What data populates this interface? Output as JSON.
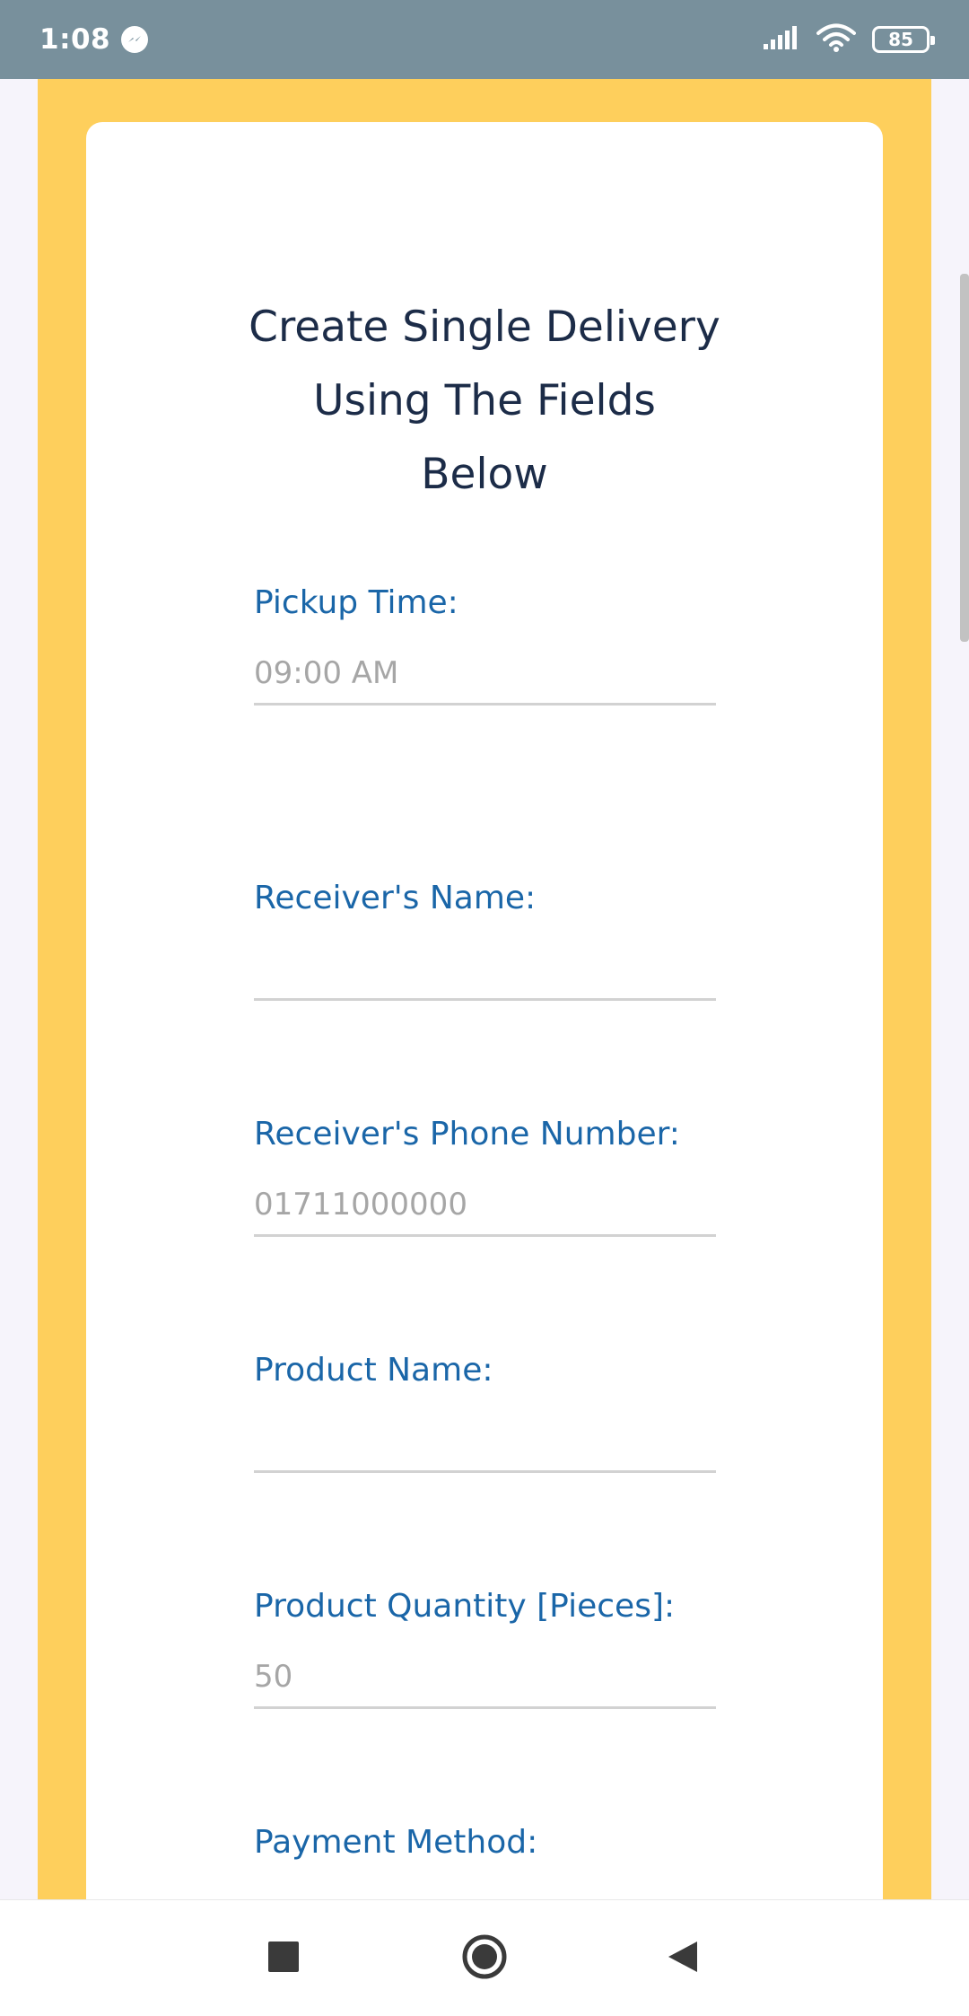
{
  "status_bar": {
    "time": "1:08",
    "battery": "85"
  },
  "form": {
    "title_lines": [
      "Create Single Delivery",
      "Using The Fields",
      "Below"
    ],
    "fields": [
      {
        "label": "Pickup Time:",
        "placeholder": "09:00 AM",
        "value": ""
      },
      {
        "label": "Receiver's Name:",
        "placeholder": "",
        "value": ""
      },
      {
        "label": "Receiver's Phone Number:",
        "placeholder": "01711000000",
        "value": ""
      },
      {
        "label": "Product Name:",
        "placeholder": "",
        "value": ""
      },
      {
        "label": "Product Quantity [Pieces]:",
        "placeholder": "50",
        "value": ""
      },
      {
        "label": "Payment Method:"
      }
    ]
  },
  "colors": {
    "status_bar": "#78909c",
    "frame": "#fecf5c",
    "label": "#1a66a8",
    "title": "#1c2c48"
  },
  "icons": {
    "status": [
      "messenger-icon",
      "signal-icon",
      "wifi-icon",
      "battery-icon"
    ],
    "nav": [
      "recents-icon",
      "home-icon",
      "back-icon"
    ]
  }
}
